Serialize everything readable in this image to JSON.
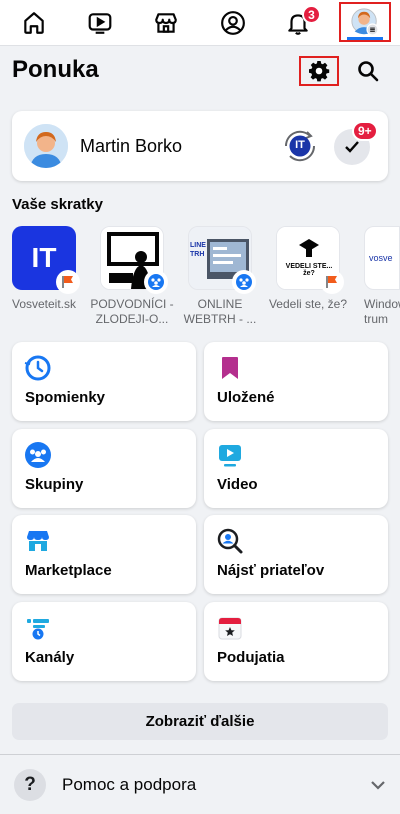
{
  "nav": {
    "notifications_badge": "3"
  },
  "header": {
    "title": "Ponuka"
  },
  "profile": {
    "name": "Martin Borko",
    "switch_initials": "IT",
    "notif_badge": "9+"
  },
  "shortcuts": {
    "title": "Vaše skratky",
    "items": [
      {
        "label": "Vosveteit.sk",
        "thumb_text": "IT"
      },
      {
        "label": "PODVODNÍCI -ZLODEJI-O..."
      },
      {
        "label": "ONLINE WEBTRH - ...",
        "thumb_text": "LINE TRH"
      },
      {
        "label": "Vedeli ste, že?",
        "thumb_text": "VEDELI STE... že?"
      },
      {
        "label": "Window trum",
        "thumb_text": "vosve"
      }
    ]
  },
  "tiles": [
    {
      "label": "Spomienky",
      "icon": "clock-history-icon"
    },
    {
      "label": "Uložené",
      "icon": "bookmark-icon"
    },
    {
      "label": "Skupiny",
      "icon": "groups-icon"
    },
    {
      "label": "Video",
      "icon": "video-icon"
    },
    {
      "label": "Marketplace",
      "icon": "store-icon"
    },
    {
      "label": "Nájsť priateľov",
      "icon": "find-friends-icon"
    },
    {
      "label": "Kanály",
      "icon": "feeds-icon"
    },
    {
      "label": "Podujatia",
      "icon": "calendar-icon"
    }
  ],
  "see_more": "Zobraziť ďalšie",
  "help": {
    "label": "Pomoc a podpora"
  },
  "colors": {
    "accent": "#1877f2",
    "badge": "#e41e3f",
    "highlight_box": "#e0201f"
  }
}
